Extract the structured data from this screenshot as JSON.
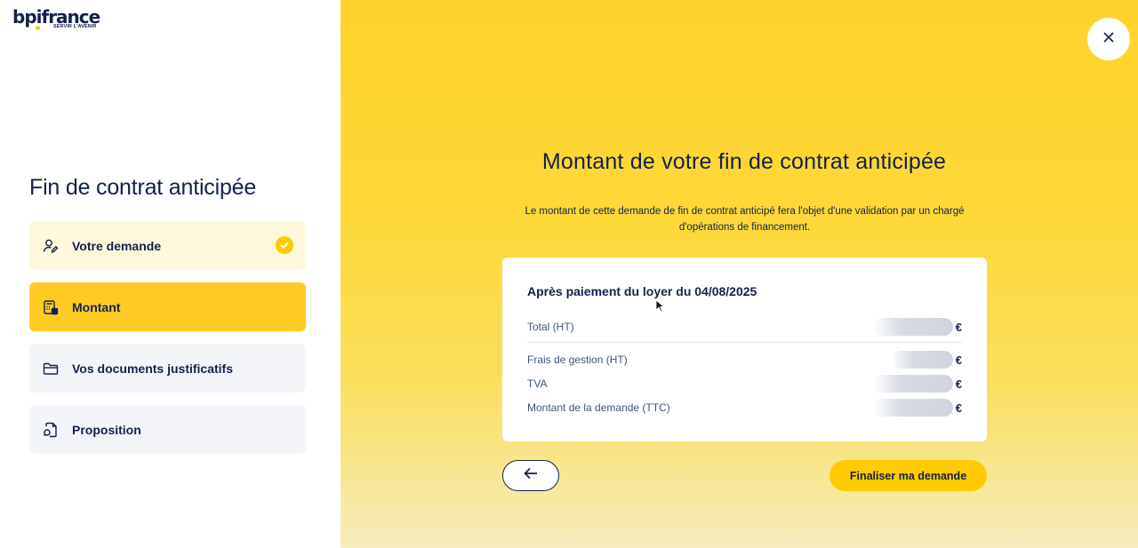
{
  "brand": {
    "name": "bpifrance",
    "tagline": "SERVIR L'AVENIR"
  },
  "sidebar": {
    "title": "Fin de contrat anticipée",
    "steps": [
      {
        "label": "Votre demande",
        "icon": "user-edit-icon",
        "state": "done"
      },
      {
        "label": "Montant",
        "icon": "calculator-icon",
        "state": "active"
      },
      {
        "label": "Vos documents justificatifs",
        "icon": "folder-icon",
        "state": "todo"
      },
      {
        "label": "Proposition",
        "icon": "document-search-icon",
        "state": "todo"
      }
    ]
  },
  "main": {
    "title": "Montant de votre fin de contrat anticipée",
    "description": "Le montant de cette demande de fin de contrat anticipé fera l'objet d'une validation par un chargé d'opérations de financement.",
    "card": {
      "title": "Après paiement du loyer du 04/08/2025",
      "rows": [
        {
          "label": "Total (HT)",
          "currency": "€"
        },
        {
          "label": "Frais de gestion (HT)",
          "currency": "€"
        },
        {
          "label": "TVA",
          "currency": "€"
        },
        {
          "label": "Montant de la demande (TTC)",
          "currency": "€"
        }
      ]
    },
    "buttons": {
      "back_icon": "arrow-left-icon",
      "submit": "Finaliser ma demande",
      "close_icon": "close-icon"
    }
  },
  "colors": {
    "accent": "#fecb00",
    "navy": "#13224a",
    "active_step": "#fecb25",
    "done_step": "#fff8dc",
    "todo_step": "#f3f5f9"
  }
}
